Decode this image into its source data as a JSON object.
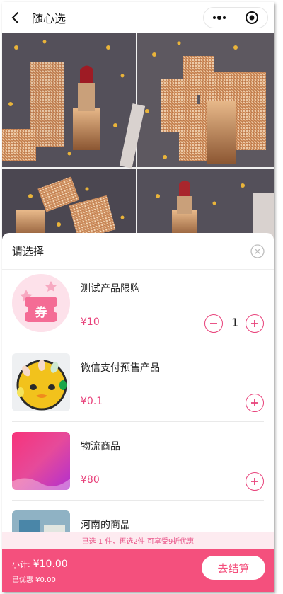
{
  "header": {
    "title": "随心选",
    "back_icon": "chevron-left-icon",
    "more_icon": "more-dots-icon",
    "close_icon": "target-circle-icon"
  },
  "sheet": {
    "title": "请选择",
    "close_icon": "close-circle-icon",
    "items": [
      {
        "name": "测试产品限购",
        "price": "¥10",
        "quantity": "1",
        "thumb": "coupon",
        "coupon_text": "券"
      },
      {
        "name": "微信支付预售产品",
        "price": "¥0.1",
        "thumb": "nails"
      },
      {
        "name": "物流商品",
        "price": "¥80",
        "thumb": "gradient"
      },
      {
        "name": "河南的商品",
        "thumb": "photo"
      }
    ]
  },
  "promo": {
    "text": "已选 1 件，再选2件 可享受9折优惠"
  },
  "footer": {
    "subtotal_label": "小计:",
    "subtotal_value": "¥10.00",
    "discount": "已优惠 ¥0.00",
    "checkout_label": "去结算"
  },
  "colors": {
    "accent": "#f4507d",
    "price": "#e8417a",
    "promo_bg": "#fdebf0"
  }
}
